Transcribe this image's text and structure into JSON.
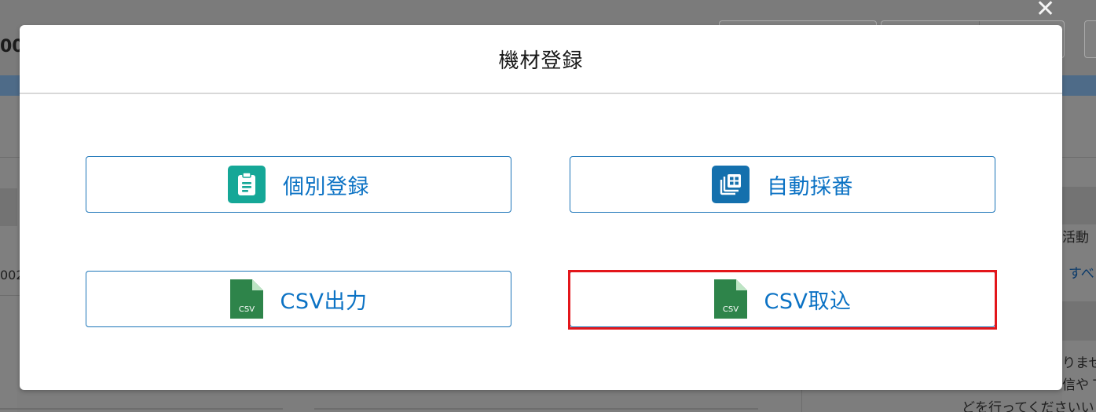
{
  "background": {
    "page_title_fragment": "00",
    "left_row_fragment": "002",
    "right_texts": [
      "活動",
      "すべ",
      "りませ",
      "信や T"
    ],
    "bottom_text_fragment": "どを行ってくださいい",
    "close_glyph": "✕"
  },
  "modal": {
    "title": "機材登録",
    "buttons": [
      {
        "label": "個別登録",
        "icon": "clipboard-icon",
        "icon_color": "#15a797"
      },
      {
        "label": "自動採番",
        "icon": "stacked-list-icon",
        "icon_color": "#1470ad"
      },
      {
        "label": "CSV出力",
        "icon": "csv-file-icon",
        "icon_color": "#2e844a"
      },
      {
        "label": "CSV取込",
        "icon": "csv-file-icon",
        "icon_color": "#2e844a",
        "highlighted": true
      }
    ],
    "csv_icon_text": "CSV"
  },
  "colors": {
    "accent_text": "#0b72c4",
    "button_border": "#1b74b8",
    "highlight": "#e3161b",
    "overlay": "#7d7d7d"
  }
}
